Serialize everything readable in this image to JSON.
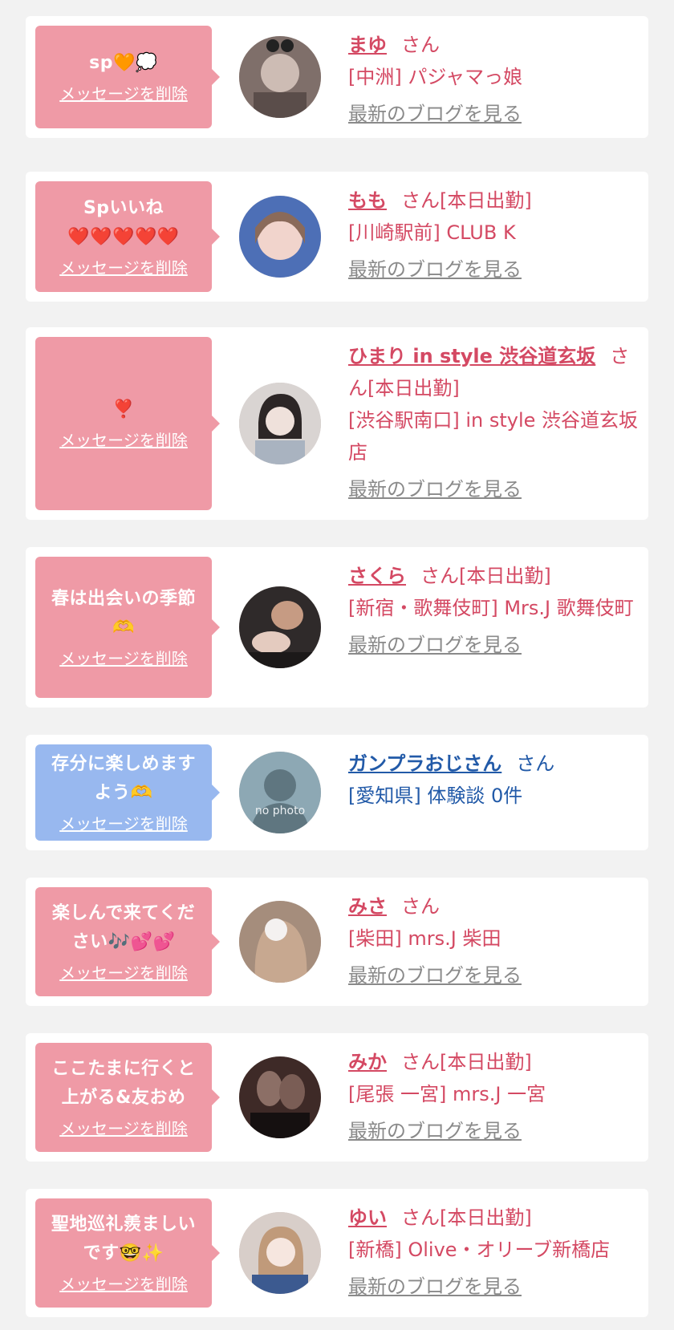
{
  "delete_label": "メッセージを削除",
  "blog_label": "最新のブログを見る",
  "items": [
    {
      "msg_lines": [
        "sp🧡💭"
      ],
      "name": "まゆ",
      "honorific": "さん",
      "location": "[中洲] パジャマっ娘",
      "theme": "pink",
      "avatar_color": "#7f6f6a"
    },
    {
      "msg_lines": [
        "Spいいね",
        "❤️❤️❤️❤️❤️"
      ],
      "name": "もも",
      "honorific": "さん[本日出勤]",
      "location": "[川崎駅前] CLUB K",
      "theme": "pink",
      "avatar_color": "#cbbcc6"
    },
    {
      "msg_lines": [
        "❣️"
      ],
      "name": "ひまり in style 渋谷道玄坂",
      "honorific": "さん[本日出勤]",
      "location": "[渋谷駅南口] in style 渋谷道玄坂店",
      "theme": "pink",
      "avatar_color": "#bdb7b6"
    },
    {
      "msg_lines": [
        "春は出会いの季節",
        "🫶"
      ],
      "name": "さくら",
      "honorific": "さん[本日出勤]",
      "location": "[新宿・歌舞伎町] Mrs.J 歌舞伎町",
      "theme": "pink",
      "avatar_color": "#3a3434"
    },
    {
      "msg_lines": [
        "存分に楽しめます",
        "よう🫶"
      ],
      "name": "ガンプラおじさん",
      "honorific": "さん",
      "location": "[愛知県] 体験談 0件",
      "theme": "blue",
      "avatar_color": "#8da8b4",
      "no_photo": "no photo"
    },
    {
      "msg_lines": [
        "楽しんで来てくだ",
        "さい🎶💕💕"
      ],
      "name": "みさ",
      "honorific": "さん",
      "location": "[柴田] mrs.J 柴田",
      "theme": "pink",
      "avatar_color": "#a58d7c"
    },
    {
      "msg_lines": [
        "ここたまに行くと",
        "上がる&友おめ"
      ],
      "name": "みか",
      "honorific": "さん[本日出勤]",
      "location": "[尾張 一宮] mrs.J 一宮",
      "theme": "pink",
      "avatar_color": "#3e2a27"
    },
    {
      "msg_lines": [
        "聖地巡礼羨ましい",
        "です🤓✨"
      ],
      "name": "ゆい",
      "honorific": "さん[本日出勤]",
      "location": "[新橋] Olive・オリーブ新橋店",
      "theme": "pink",
      "avatar_color": "#d8cec9"
    }
  ]
}
